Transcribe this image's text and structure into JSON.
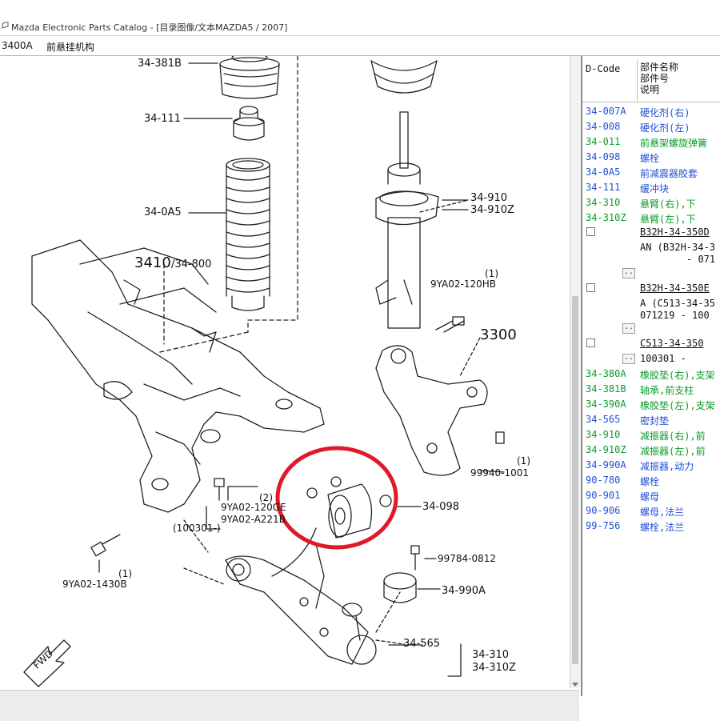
{
  "window": {
    "title": "Mazda Electronic Parts Catalog - [目录图像/文本MAZDA5 / 2007]"
  },
  "group": {
    "code": "3400A",
    "name": "前悬挂机构"
  },
  "diagram": {
    "labels": {
      "l_34_381b": "34-381B",
      "l_34_111": "34-111",
      "l_34_0a5": "34-0A5",
      "l_3410": "3410",
      "l_34_800": "/34-800",
      "l_34_910": "34-910",
      "l_34_910z": "34-910Z",
      "l_1a": "(1)",
      "l_9ya02_120hb": "9YA02-120HB",
      "l_3300": "3300",
      "l_1b": "(1)",
      "l_99940": "99940-1001",
      "l_34_098": "34-098",
      "l_2": "(2)",
      "l_9ya02_120ge": "9YA02-120GE",
      "l_9ya02_a221b": "9YA02-A221B",
      "l_100301": "(100301-)",
      "l_1c": "(1)",
      "l_9ya02_1430b": "9YA02-1430B",
      "l_99784": "99784-0812",
      "l_34_990a": "34-990A",
      "l_34_565": "34-565",
      "l_34_310": "34-310",
      "l_34_310z": "34-310Z",
      "l_fwd": "FWD"
    },
    "highlight_color": "#e0192a"
  },
  "parts_panel": {
    "header": {
      "dcode": "D-Code",
      "col1": "部件名称",
      "col2": "部件号",
      "col3": "说明"
    },
    "rows": [
      {
        "code": "34-007A",
        "name": "硬化剂(右)",
        "color": "blue"
      },
      {
        "code": "34-008",
        "name": "硬化剂(左)",
        "color": "blue"
      },
      {
        "code": "34-011",
        "name": "前悬架螺旋弹簧",
        "color": "green"
      },
      {
        "code": "34-098",
        "name": "螺栓",
        "color": "blue"
      },
      {
        "code": "34-0A5",
        "name": "前减震器胶套",
        "color": "blue"
      },
      {
        "code": "34-111",
        "name": "缓冲块",
        "color": "blue"
      },
      {
        "code": "34-310",
        "name": "悬臂(右),下",
        "color": "green"
      },
      {
        "code": "34-310Z",
        "name": "悬臂(左),下",
        "color": "green"
      }
    ],
    "detail": {
      "part1": "B32H-34-350D",
      "part1_desc_a": "AN (B32H-34-3",
      "part1_desc_b": "- 071",
      "dots1": "..",
      "part2": "B32H-34-350E",
      "part2_desc_a": "A (C513-34-35",
      "part2_desc_b": "071219  - 100",
      "dots2": "..",
      "part3": "C513-34-350",
      "part3_desc": "100301  -",
      "dots3": ".."
    },
    "rows2": [
      {
        "code": "34-380A",
        "name": "橡胶垫(右),支架",
        "color": "green"
      },
      {
        "code": "34-381B",
        "name": "轴承,前支柱",
        "color": "green"
      },
      {
        "code": "34-390A",
        "name": "橡胶垫(左),支架",
        "color": "green"
      },
      {
        "code": "34-565",
        "name": "密封垫",
        "color": "blue"
      },
      {
        "code": "34-910",
        "name": "减振器(右),前",
        "color": "green"
      },
      {
        "code": "34-910Z",
        "name": "减振器(左),前",
        "color": "green"
      },
      {
        "code": "34-990A",
        "name": "减振器,动力",
        "color": "blue"
      },
      {
        "code": "90-780",
        "name": "螺栓",
        "color": "blue"
      },
      {
        "code": "90-901",
        "name": "螺母",
        "color": "blue"
      },
      {
        "code": "90-906",
        "name": "螺母,法兰",
        "color": "blue"
      },
      {
        "code": "99-756",
        "name": "螺栓,法兰",
        "color": "blue"
      }
    ]
  }
}
